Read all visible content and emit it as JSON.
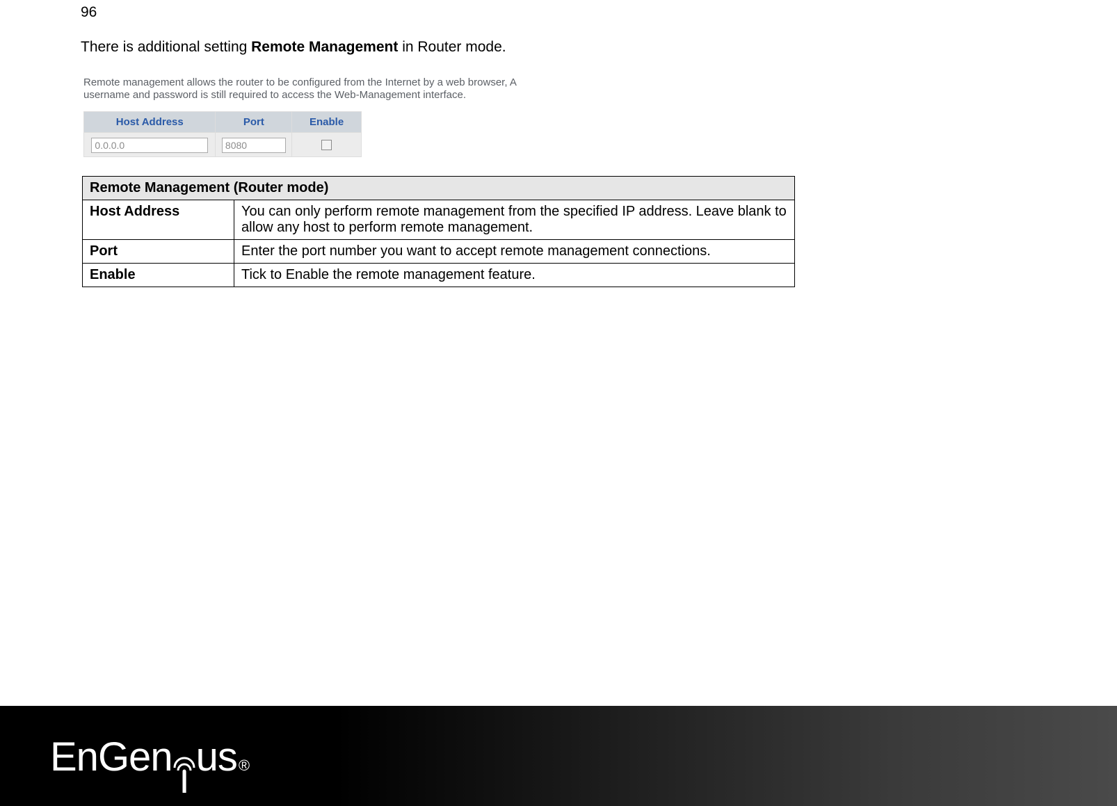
{
  "page_number": "96",
  "intro": {
    "prefix": "There is additional setting ",
    "bold": "Remote Management",
    "suffix": " in Router mode."
  },
  "ui": {
    "description": "Remote management allows the router to be configured from the Internet by a web browser, A username and password is still required to access the Web-Management interface.",
    "headers": {
      "host": "Host Address",
      "port": "Port",
      "enable": "Enable"
    },
    "values": {
      "host": "0.0.0.0",
      "port": "8080",
      "enable_checked": false
    }
  },
  "desc_table": {
    "title": "Remote Management (Router mode)",
    "rows": [
      {
        "label": "Host Address",
        "text": "You can only perform remote management from the specified IP address. Leave blank to allow any host to perform remote management."
      },
      {
        "label": "Port",
        "text": "Enter the port number you want to accept remote management connections."
      },
      {
        "label": "Enable",
        "text": "Tick to Enable the remote management feature."
      }
    ]
  },
  "footer": {
    "brand": {
      "pre": "EnGen",
      "post": "us",
      "reg": "®"
    }
  }
}
